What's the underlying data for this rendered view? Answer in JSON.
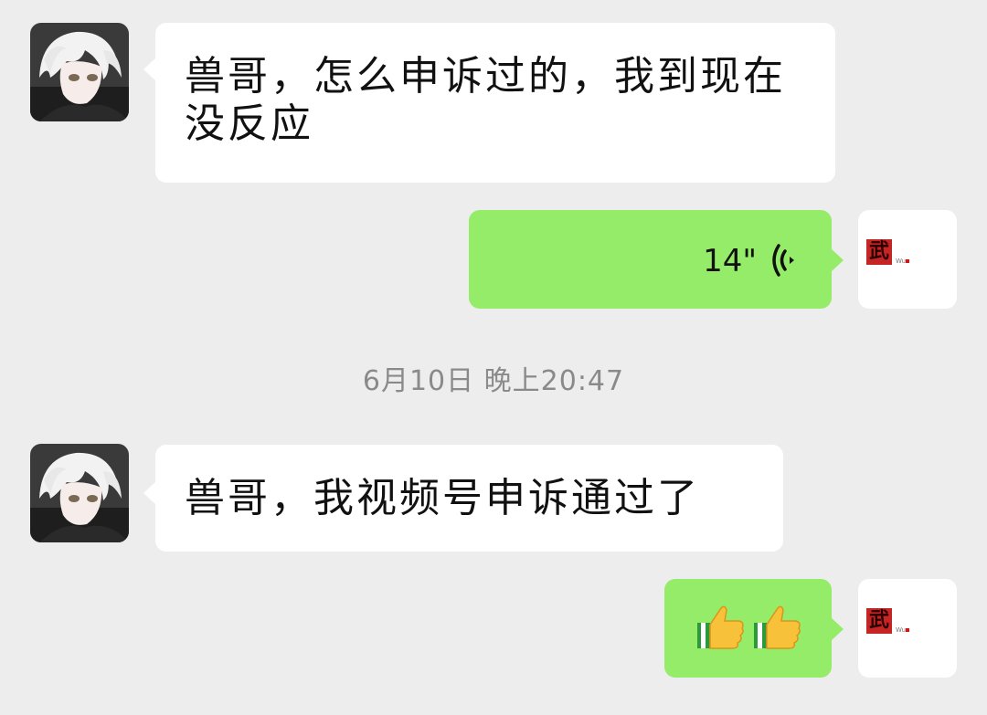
{
  "messages": [
    {
      "side": "left",
      "type": "text",
      "text": "兽哥，怎么申诉过的，我到现在没反应"
    },
    {
      "side": "right",
      "type": "voice",
      "duration": "14\"",
      "icon": "voice-wave-icon"
    },
    {
      "side": "left",
      "type": "text",
      "text": "兽哥，我视频号申诉通过了"
    },
    {
      "side": "right",
      "type": "emoji",
      "emojis": [
        "👍",
        "👍"
      ]
    }
  ],
  "timestamp": "6月10日 晚上20:47",
  "colors": {
    "background": "#ededed",
    "incoming_bubble": "#ffffff",
    "outgoing_bubble": "#95ec69",
    "timestamp_text": "#8a8a8a"
  },
  "my_avatar": {
    "glyph": "武"
  }
}
